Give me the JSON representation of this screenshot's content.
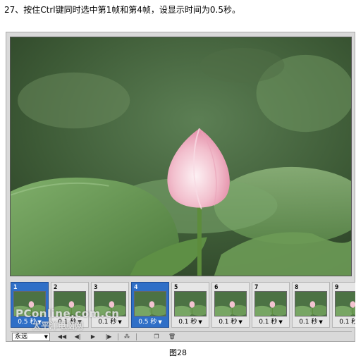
{
  "instruction": "27、按住Ctrl键同时选中第1帧和第4帧，设显示时间为0.5秒。",
  "frames": [
    {
      "number": "1",
      "delay": "0.5 秒",
      "selected": true
    },
    {
      "number": "2",
      "delay": "0.1 秒",
      "selected": false
    },
    {
      "number": "3",
      "delay": "0.1 秒",
      "selected": false
    },
    {
      "number": "4",
      "delay": "0.5 秒",
      "selected": true
    },
    {
      "number": "5",
      "delay": "0.1 秒",
      "selected": false
    },
    {
      "number": "6",
      "delay": "0.1 秒",
      "selected": false
    },
    {
      "number": "7",
      "delay": "0.1 秒",
      "selected": false
    },
    {
      "number": "8",
      "delay": "0.1 秒",
      "selected": false
    },
    {
      "number": "9",
      "delay": "0.1 秒",
      "selected": false
    }
  ],
  "toolbar": {
    "loop_value": "永远",
    "buttons": [
      "first-frame-icon",
      "previous-frame-icon",
      "play-icon",
      "next-frame-icon",
      "tween-icon",
      "duplicate-frame-icon",
      "delete-frame-icon"
    ]
  },
  "watermark": {
    "line1": "PConline.com.cn",
    "line2": "太平洋电脑网"
  },
  "caption": "图28",
  "colors": {
    "selected_frame": "#2f6fc7",
    "panel": "#d9d9d9"
  }
}
